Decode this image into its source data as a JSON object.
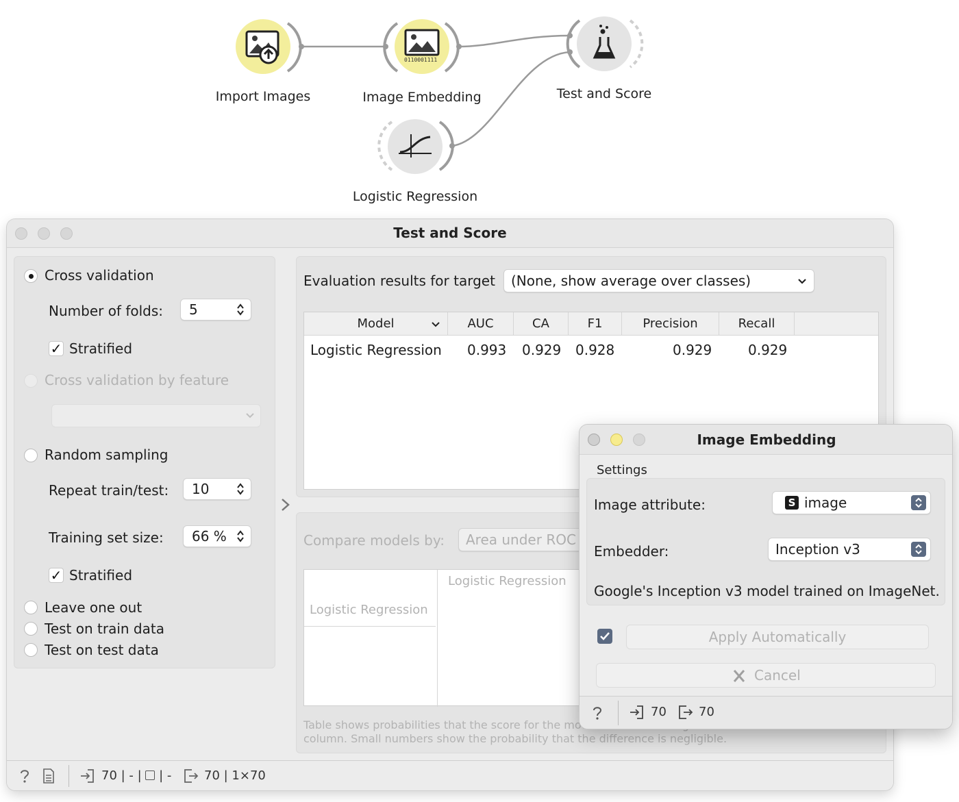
{
  "canvas": {
    "nodes": {
      "import_images": "Import Images",
      "image_embedding": "Image Embedding",
      "test_and_score": "Test and Score",
      "logistic_regression": "Logistic Regression"
    },
    "embed_bits": "0110001111"
  },
  "test_score": {
    "title": "Test and Score",
    "sampling": {
      "cross_validation": "Cross validation",
      "folds_label": "Number of folds:",
      "folds_value": "5",
      "stratified_1": "Stratified",
      "cv_by_feature": "Cross validation by feature",
      "random_sampling": "Random sampling",
      "repeat_label": "Repeat train/test:",
      "repeat_value": "10",
      "train_size_label": "Training set size:",
      "train_size_value": "66 %",
      "stratified_2": "Stratified",
      "leave_one_out": "Leave one out",
      "test_on_train": "Test on train data",
      "test_on_test": "Test on test data"
    },
    "eval_label": "Evaluation results for target",
    "target_value": "(None, show average over classes)",
    "table": {
      "headers": [
        "Model",
        "AUC",
        "CA",
        "F1",
        "Precision",
        "Recall"
      ],
      "rows": [
        {
          "model": "Logistic Regression",
          "auc": "0.993",
          "ca": "0.929",
          "f1": "0.928",
          "precision": "0.929",
          "recall": "0.929"
        }
      ]
    },
    "compare_label": "Compare models by:",
    "compare_value": "Area under ROC",
    "compare_col": "Logistic Regression",
    "compare_row": "Logistic Regression",
    "footnote_1": "Table shows probabilities that the score for the model in the row is higher than that of the model in the",
    "footnote_2": "column. Small numbers show the probability that the difference is negligible.",
    "status": {
      "input": "70 | - | ",
      "input_tail": " | -",
      "output": "70 | 1×70"
    }
  },
  "image_embedding": {
    "title": "Image Embedding",
    "settings_label": "Settings",
    "attr_label": "Image attribute:",
    "attr_badge": "S",
    "attr_value": "image",
    "embedder_label": "Embedder:",
    "embedder_value": "Inception v3",
    "description": "Google's Inception v3 model trained on ImageNet.",
    "apply_auto": "Apply Automatically",
    "cancel": "Cancel",
    "status_in": "70",
    "status_out": "70"
  },
  "colors": {
    "node_yellow": "#f3ee9c",
    "node_grey": "#e4e4e4",
    "stepper_blue": "#5b6a82"
  }
}
